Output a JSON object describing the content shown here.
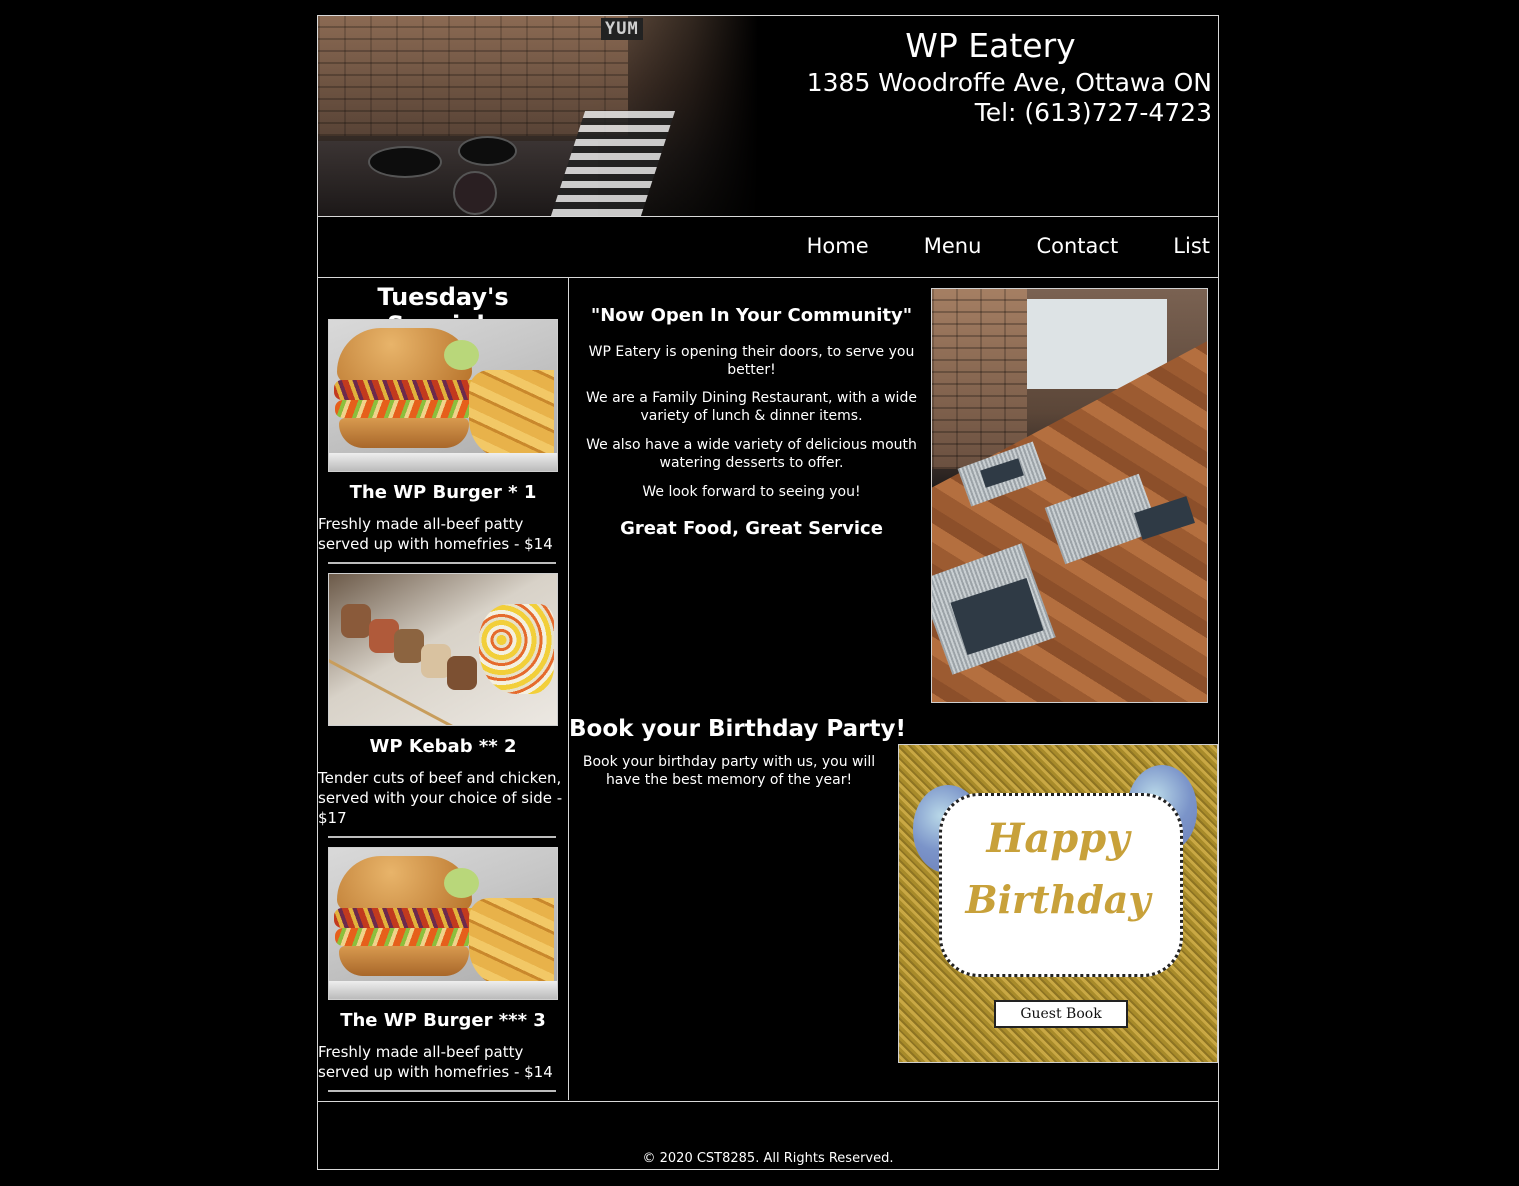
{
  "header": {
    "photo_label": "YUM",
    "title": "WP Eatery",
    "address": "1385 Woodroffe Ave, Ottawa ON",
    "phone": "Tel: (613)727-4723"
  },
  "nav": {
    "items": [
      {
        "label": "Home"
      },
      {
        "label": "Menu"
      },
      {
        "label": "Contact"
      },
      {
        "label": "List"
      }
    ]
  },
  "specials": {
    "heading": "Tuesday's Specials",
    "items": [
      {
        "name": "The WP Burger * 1",
        "description": "Freshly made all-beef patty served up with homefries - $14"
      },
      {
        "name": "WP Kebab ** 2",
        "description": "Tender cuts of beef and chicken, served with your choice of side - $17"
      },
      {
        "name": "The WP Burger *** 3",
        "description": "Freshly made all-beef patty served up with homefries - $14"
      }
    ]
  },
  "intro": {
    "heading": "\"Now Open In Your Community\"",
    "paragraphs": [
      "WP Eatery is opening their doors, to serve you better!",
      "We are a Family Dining Restaurant, with a wide variety of lunch & dinner items.",
      "We also have a wide variety of delicious mouth watering desserts to offer.",
      "We look forward to seeing you!"
    ],
    "tagline": "Great Food, Great Service"
  },
  "party": {
    "heading": "Book your Birthday Party!",
    "text": "Book your birthday party with us, you will have the best memory of the year!",
    "card_line1": "Happy",
    "card_line2": "Birthday",
    "card_ribbon": "Guest Book"
  },
  "footer": {
    "copyright": "© 2020 CST8285. All Rights Reserved."
  }
}
